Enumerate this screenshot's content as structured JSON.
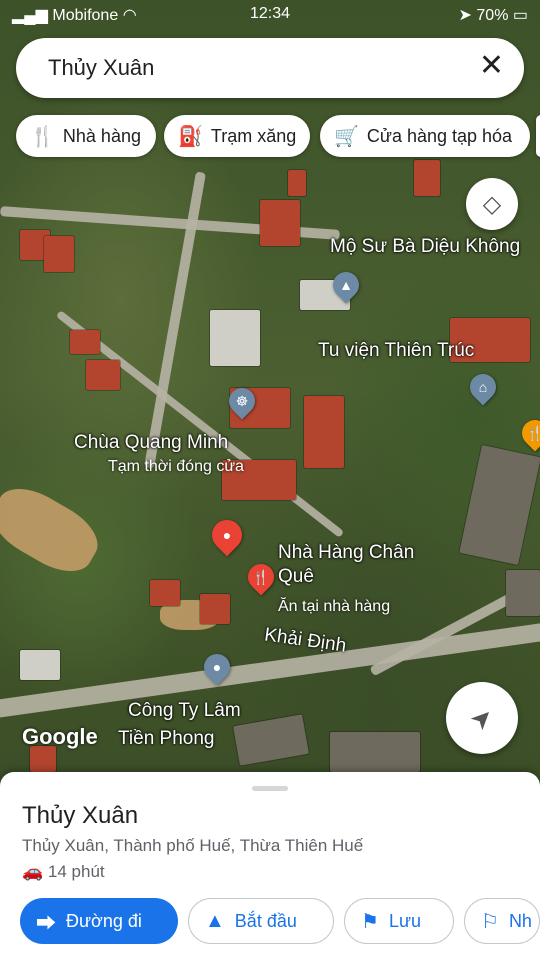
{
  "status_bar": {
    "carrier": "Mobifone",
    "time": "12:34",
    "battery": "70%"
  },
  "search": {
    "query": "Thủy Xuân"
  },
  "chips": [
    {
      "icon": "🍴",
      "label": "Nhà hàng"
    },
    {
      "icon": "⛽",
      "label": "Trạm xăng"
    },
    {
      "icon": "🛒",
      "label": "Cửa hàng tạp hóa"
    }
  ],
  "map_labels": {
    "mo_su": "Mộ Sư Bà Diệu Không",
    "tu_vien": "Tu viện Thiên Trúc",
    "chua": "Chùa Quang Minh",
    "chua_status": "Tạm thời đóng cửa",
    "nha_hang_line1": "Nhà Hàng Chân",
    "nha_hang_line2": "Quê",
    "nha_hang_sub": "Ăn tại nhà hàng",
    "road": "Khải Định",
    "cong_ty_line1": "Công Ty Lâm",
    "cong_ty_line2": "Tiền Phong",
    "google": "Google"
  },
  "sheet": {
    "place_name": "Thủy Xuân",
    "address": "Thủy Xuân, Thành phố Huế, Thừa Thiên Huế",
    "eta": "14 phút"
  },
  "actions": {
    "directions": "Đường đi",
    "start": "Bắt đầu",
    "save": "Lưu",
    "label": "Nh"
  }
}
